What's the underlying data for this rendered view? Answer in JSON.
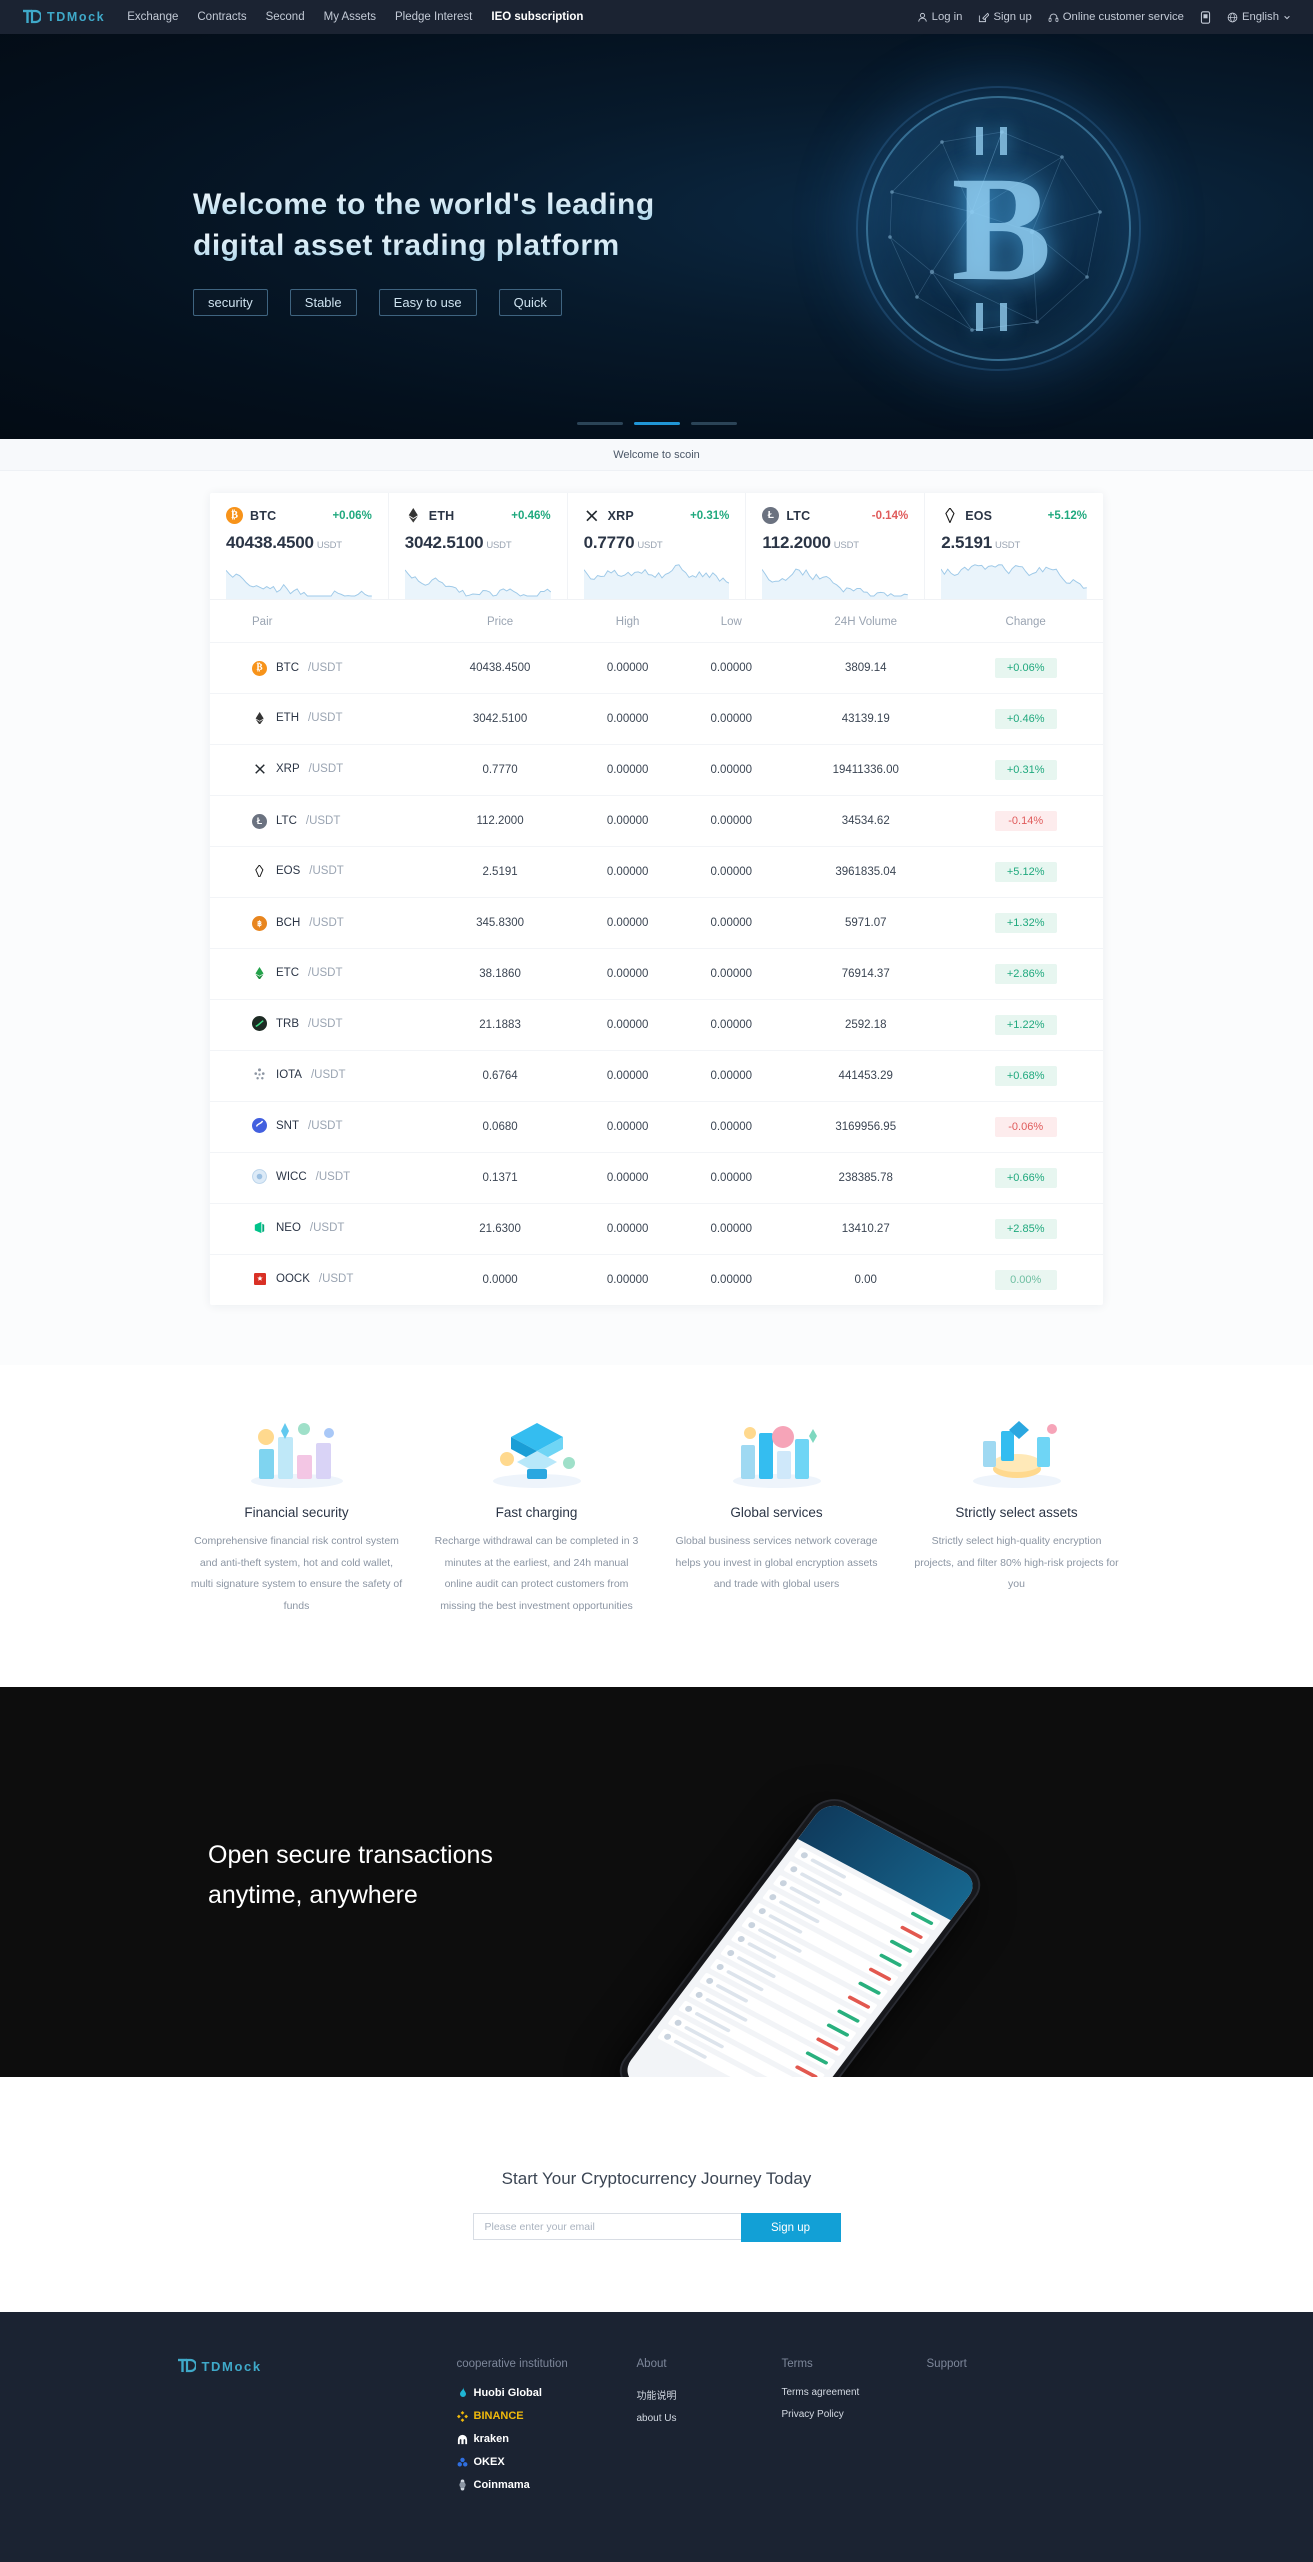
{
  "nav": {
    "brand": "TDMock",
    "brand_icon": "td-logo-icon",
    "links": [
      {
        "label": "Exchange",
        "active": false
      },
      {
        "label": "Contracts",
        "active": false
      },
      {
        "label": "Second",
        "active": false
      },
      {
        "label": "My Assets",
        "active": false
      },
      {
        "label": "Pledge Interest",
        "active": false
      },
      {
        "label": "IEO subscription",
        "active": true
      }
    ],
    "right": [
      {
        "label": "Log in",
        "icon": "user-icon"
      },
      {
        "label": "Sign up",
        "icon": "edit-square-icon"
      },
      {
        "label": "Online customer service",
        "icon": "headset-icon"
      },
      {
        "label": "",
        "icon": "mobile-app-icon"
      },
      {
        "label": "English",
        "icon": "globe-icon",
        "caret": "chevron-down-icon"
      }
    ]
  },
  "hero": {
    "title_line1": "Welcome to the world's leading",
    "title_line2": "digital asset trading platform",
    "tags": [
      "security",
      "Stable",
      "Easy to use",
      "Quick"
    ],
    "art_icon": "bitcoin-globe-icon",
    "carousel": {
      "count": 3,
      "active_index": 1
    }
  },
  "notice": {
    "text": "Welcome to scoin"
  },
  "market": {
    "tickers": [
      {
        "symbol": "BTC",
        "change": "+0.06%",
        "dir": "up",
        "price": "40438.4500",
        "unit": "USDT",
        "icon": "btc-icon",
        "color": "#f7931a"
      },
      {
        "symbol": "ETH",
        "change": "+0.46%",
        "dir": "up",
        "price": "3042.5100",
        "unit": "USDT",
        "icon": "eth-icon",
        "color": "#343434"
      },
      {
        "symbol": "XRP",
        "change": "+0.31%",
        "dir": "up",
        "price": "0.7770",
        "unit": "USDT",
        "icon": "xrp-icon",
        "color": "#23292f"
      },
      {
        "symbol": "LTC",
        "change": "-0.14%",
        "dir": "down",
        "price": "112.2000",
        "unit": "USDT",
        "icon": "ltc-icon",
        "color": "#6b7280"
      },
      {
        "symbol": "EOS",
        "change": "+5.12%",
        "dir": "up",
        "price": "2.5191",
        "unit": "USDT",
        "icon": "eos-icon",
        "color": "#1a1a1a"
      }
    ],
    "columns": [
      "Pair",
      "Price",
      "High",
      "Low",
      "24H Volume",
      "Change"
    ],
    "rows": [
      {
        "base": "BTC",
        "quote": "/USDT",
        "price": "40438.4500",
        "price_dir": "up",
        "high": "0.00000",
        "low": "0.00000",
        "volume": "3809.14",
        "change": "+0.06%",
        "chg_dir": "up",
        "color": "#f7931a",
        "icon": "btc-icon"
      },
      {
        "base": "ETH",
        "quote": "/USDT",
        "price": "3042.5100",
        "price_dir": "up",
        "high": "0.00000",
        "low": "0.00000",
        "volume": "43139.19",
        "change": "+0.46%",
        "chg_dir": "up",
        "color": "#343434",
        "icon": "eth-icon"
      },
      {
        "base": "XRP",
        "quote": "/USDT",
        "price": "0.7770",
        "price_dir": "up",
        "high": "0.00000",
        "low": "0.00000",
        "volume": "19411336.00",
        "change": "+0.31%",
        "chg_dir": "up",
        "color": "#23292f",
        "icon": "xrp-icon"
      },
      {
        "base": "LTC",
        "quote": "/USDT",
        "price": "112.2000",
        "price_dir": "down",
        "high": "0.00000",
        "low": "0.00000",
        "volume": "34534.62",
        "change": "-0.14%",
        "chg_dir": "down",
        "color": "#6b7280",
        "icon": "ltc-icon"
      },
      {
        "base": "EOS",
        "quote": "/USDT",
        "price": "2.5191",
        "price_dir": "up",
        "high": "0.00000",
        "low": "0.00000",
        "volume": "3961835.04",
        "change": "+5.12%",
        "chg_dir": "up",
        "color": "#1a1a1a",
        "icon": "eos-icon"
      },
      {
        "base": "BCH",
        "quote": "/USDT",
        "price": "345.8300",
        "price_dir": "up",
        "high": "0.00000",
        "low": "0.00000",
        "volume": "5971.07",
        "change": "+1.32%",
        "chg_dir": "up",
        "color": "#e8851e",
        "icon": "bch-icon"
      },
      {
        "base": "ETC",
        "quote": "/USDT",
        "price": "38.1860",
        "price_dir": "up",
        "high": "0.00000",
        "low": "0.00000",
        "volume": "76914.37",
        "change": "+2.86%",
        "chg_dir": "up",
        "color": "#23a24a",
        "icon": "etc-icon"
      },
      {
        "base": "TRB",
        "quote": "/USDT",
        "price": "21.1883",
        "price_dir": "up",
        "high": "0.00000",
        "low": "0.00000",
        "volume": "2592.18",
        "change": "+1.22%",
        "chg_dir": "up",
        "color": "#1d2b24",
        "icon": "trb-icon"
      },
      {
        "base": "IOTA",
        "quote": "/USDT",
        "price": "0.6764",
        "price_dir": "up",
        "high": "0.00000",
        "low": "0.00000",
        "volume": "441453.29",
        "change": "+0.68%",
        "chg_dir": "up",
        "color": "#8d96a3",
        "icon": "iota-icon"
      },
      {
        "base": "SNT",
        "quote": "/USDT",
        "price": "0.0680",
        "price_dir": "down",
        "high": "0.00000",
        "low": "0.00000",
        "volume": "3169956.95",
        "change": "-0.06%",
        "chg_dir": "down",
        "color": "#4360df",
        "icon": "snt-icon"
      },
      {
        "base": "WICC",
        "quote": "/USDT",
        "price": "0.1371",
        "price_dir": "up",
        "high": "0.00000",
        "low": "0.00000",
        "volume": "238385.78",
        "change": "+0.66%",
        "chg_dir": "up",
        "color": "#c7dcf0",
        "icon": "wicc-icon"
      },
      {
        "base": "NEO",
        "quote": "/USDT",
        "price": "21.6300",
        "price_dir": "up",
        "high": "0.00000",
        "low": "0.00000",
        "volume": "13410.27",
        "change": "+2.85%",
        "chg_dir": "up",
        "color": "#00c38a",
        "icon": "neo-icon"
      },
      {
        "base": "OOCK",
        "quote": "/USDT",
        "price": "0.0000",
        "price_dir": "zero",
        "high": "0.00000",
        "low": "0.00000",
        "volume": "0.00",
        "change": "0.00%",
        "chg_dir": "zero",
        "color": "#d93025",
        "icon": "oock-icon"
      }
    ]
  },
  "features": [
    {
      "icon": "financial-security-illustration",
      "title": "Financial security",
      "desc": "Comprehensive financial risk control system and anti-theft system, hot and cold wallet, multi signature system to ensure the safety of funds"
    },
    {
      "icon": "fast-charging-illustration",
      "title": "Fast charging",
      "desc": "Recharge withdrawal can be completed in 3 minutes at the earliest, and 24h manual online audit can protect customers from missing the best investment opportunities"
    },
    {
      "icon": "global-services-illustration",
      "title": "Global services",
      "desc": "Global business services network coverage helps you invest in global encryption assets and trade with global users"
    },
    {
      "icon": "strictly-select-assets-illustration",
      "title": "Strictly select assets",
      "desc": "Strictly select high-quality encryption projects, and filter 80% high-risk projects for you"
    }
  ],
  "app_banner": {
    "line1": "Open secure transactions",
    "line2": "anytime, anywhere",
    "art_icon": "smartphone-mockup-icon"
  },
  "cta": {
    "title": "Start Your Cryptocurrency Journey Today",
    "placeholder": "Please enter your email",
    "value": "",
    "button": "Sign up"
  },
  "footer": {
    "brand": "TDMock",
    "brand_icon": "td-logo-icon",
    "columns": [
      {
        "heading": "cooperative institution",
        "type": "partners",
        "items": [
          {
            "label": "Huobi Global",
            "icon": "huobi-icon"
          },
          {
            "label": "BINANCE",
            "icon": "binance-icon"
          },
          {
            "label": "kraken",
            "icon": "kraken-icon"
          },
          {
            "label": "OKEX",
            "icon": "okex-icon"
          },
          {
            "label": "Coinmama",
            "icon": "coinmama-icon"
          }
        ]
      },
      {
        "heading": "About",
        "type": "links",
        "items": [
          {
            "label": "功能说明"
          },
          {
            "label": "about Us"
          }
        ]
      },
      {
        "heading": "Terms",
        "type": "links",
        "items": [
          {
            "label": "Terms agreement"
          },
          {
            "label": "Privacy Policy"
          }
        ]
      },
      {
        "heading": "Support",
        "type": "links",
        "items": []
      }
    ]
  },
  "colors": {
    "accent": "#12a0d6",
    "up": "#20a97e",
    "down": "#e05b5b",
    "dark": "#1b2332"
  }
}
